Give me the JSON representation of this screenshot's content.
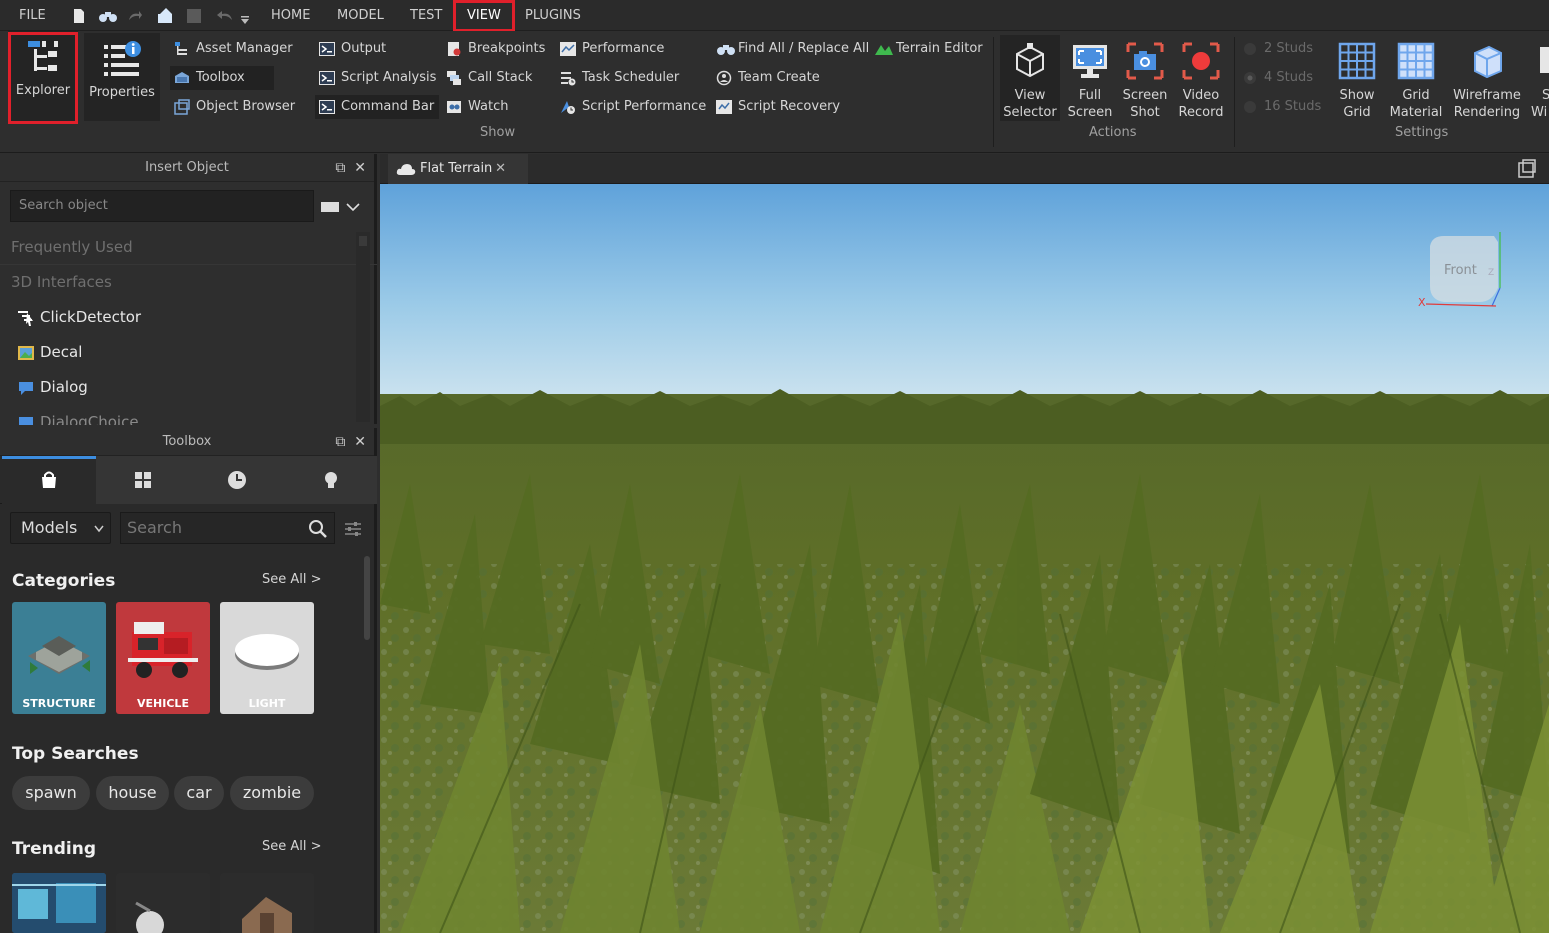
{
  "menu": {
    "file": "FILE",
    "tabs": [
      "HOME",
      "MODEL",
      "TEST",
      "VIEW",
      "PLUGINS"
    ],
    "active_tab": "VIEW"
  },
  "ribbon": {
    "explorer": "Explorer",
    "properties": "Properties",
    "col1": [
      "Asset Manager",
      "Toolbox",
      "Object Browser"
    ],
    "col2": [
      "Output",
      "Script Analysis",
      "Command Bar"
    ],
    "col3": [
      "Breakpoints",
      "Call Stack",
      "Watch"
    ],
    "col4": [
      "Performance",
      "Task Scheduler",
      "Script Performance"
    ],
    "col5": [
      "Find All / Replace All",
      "Team Create",
      "Script Recovery"
    ],
    "terrain_editor": "Terrain Editor",
    "show_group": "Show",
    "actions": {
      "view_selector": [
        "View",
        "Selector"
      ],
      "full_screen": [
        "Full",
        "Screen"
      ],
      "screen_shot": [
        "Screen",
        "Shot"
      ],
      "video_record": [
        "Video",
        "Record"
      ]
    },
    "actions_group": "Actions",
    "studs": [
      "2 Studs",
      "4 Studs",
      "16 Studs"
    ],
    "settings": {
      "show_grid": [
        "Show",
        "Grid"
      ],
      "grid_material": [
        "Grid",
        "Material"
      ],
      "wireframe": [
        "Wireframe",
        "Rendering"
      ],
      "cut_off": [
        "S",
        "Wi"
      ]
    },
    "settings_group": "Settings"
  },
  "insert_object": {
    "title": "Insert Object",
    "search_placeholder": "Search object",
    "categories": [
      "Frequently Used",
      "3D Interfaces"
    ],
    "items": [
      "ClickDetector",
      "Decal",
      "Dialog",
      "DialogChoice"
    ]
  },
  "toolbox": {
    "title": "Toolbox",
    "dropdown": "Models",
    "search_placeholder": "Search",
    "categories_title": "Categories",
    "see_all": "See All >",
    "cards": [
      "STRUCTURE",
      "VEHICLE",
      "LIGHT"
    ],
    "top_searches_title": "Top Searches",
    "top_searches": [
      "spawn",
      "house",
      "car",
      "zombie"
    ],
    "trending_title": "Trending"
  },
  "document": {
    "tab": "Flat Terrain",
    "view_cube": "Front",
    "axis_x": "X",
    "axis_z": "Z"
  },
  "colors": {
    "highlight": "#e0202b",
    "accent": "#3d8ee0",
    "sky_top": "#5fa2da",
    "grass": "#5d6e22"
  }
}
